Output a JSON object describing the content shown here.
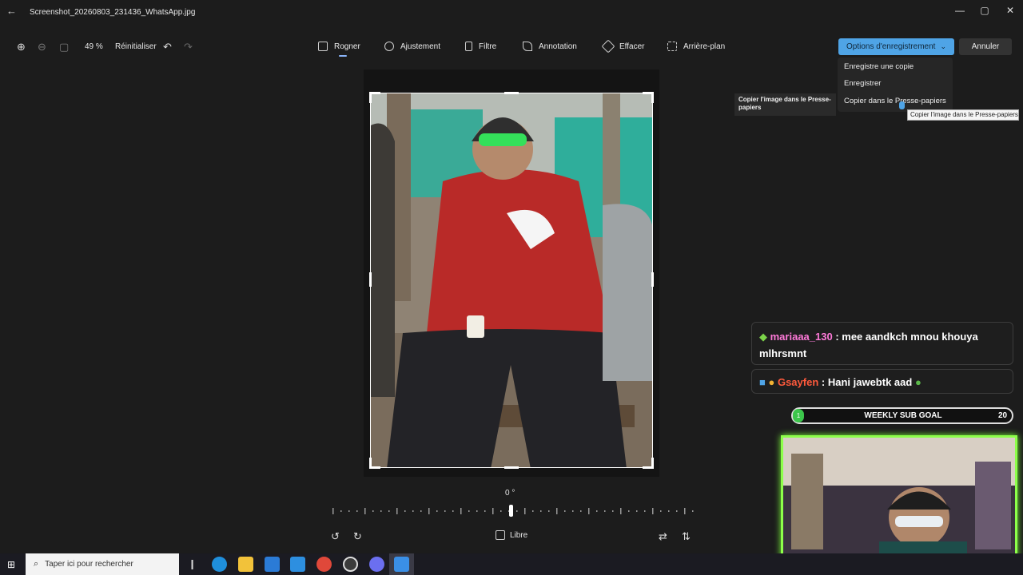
{
  "window": {
    "title": "Screenshot_20260803_231436_WhatsApp.jpg",
    "back_icon": "back-arrow-icon",
    "minimize_glyph": "—",
    "maximize_glyph": "▢",
    "close_glyph": "✕"
  },
  "toolbar": {
    "zoom_level": "49 %",
    "reset_label": "Réinitialiser",
    "tools": [
      {
        "label": "Rogner",
        "icon": "crop-icon",
        "active": true
      },
      {
        "label": "Ajustement",
        "icon": "brightness-icon",
        "active": false
      },
      {
        "label": "Filtre",
        "icon": "filter-icon",
        "active": false
      },
      {
        "label": "Annotation",
        "icon": "pen-icon",
        "active": false
      },
      {
        "label": "Effacer",
        "icon": "eraser-icon",
        "active": false
      },
      {
        "label": "Arrière-plan",
        "icon": "background-icon",
        "active": false
      }
    ],
    "save_options_label": "Options d'enregistrement",
    "cancel_label": "Annuler"
  },
  "save_menu": {
    "items": [
      "Enregistre une copie",
      "Enregistrer",
      "Copier dans le Presse-papiers"
    ]
  },
  "tooltips": {
    "left": "Copier l'image dans le Presse-papiers",
    "right": "Copier l'image dans le Presse-papiers"
  },
  "editor": {
    "rotation_angle": "0 °",
    "aspect_label": "Libre"
  },
  "stream_overlay": {
    "chat": [
      {
        "user": "mariaaa_130",
        "separator": " : ",
        "message": "mee aandkch mnou khouya mlhrsmnt",
        "user_color": "#ff7ad9"
      },
      {
        "user": "Gsayfen",
        "separator": " : ",
        "message": "Hani jawebtk aad",
        "user_color": "#ff5a3c"
      }
    ],
    "goal": {
      "start": "1",
      "label": "WEEKLY SUB GOAL",
      "target": "20",
      "progress": 0.05,
      "bar_color": "#3cc64b"
    },
    "webcam_border_color": "#8dff4a"
  },
  "taskbar": {
    "search_placeholder": "Taper ici pour rechercher",
    "apps": [
      "task-view-icon",
      "edge-icon",
      "file-explorer-icon",
      "store-icon",
      "mail-icon",
      "chrome-icon",
      "obs-icon",
      "discord-icon",
      "photos-icon"
    ]
  }
}
